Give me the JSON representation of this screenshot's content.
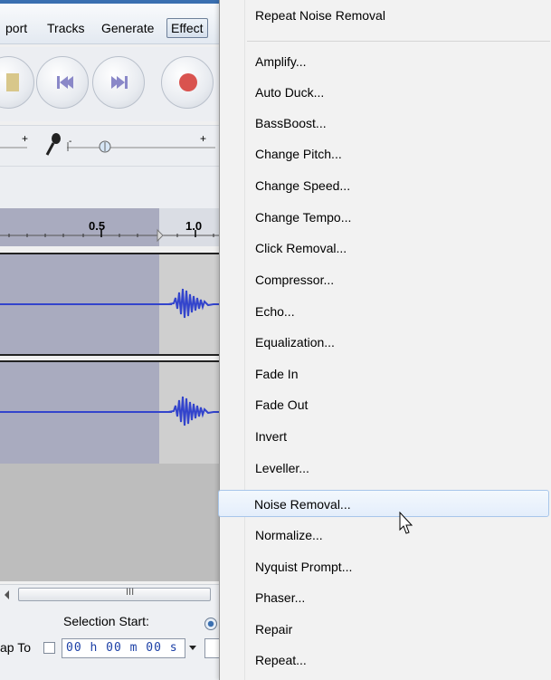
{
  "menubar": {
    "items": [
      {
        "label": "port"
      },
      {
        "label": "Tracks"
      },
      {
        "label": "Generate"
      },
      {
        "label": "Effect"
      }
    ]
  },
  "ruler": {
    "labels": [
      "0.5",
      "1.0"
    ]
  },
  "scroll": {
    "grip": "III"
  },
  "selection": {
    "label": "Selection Start:",
    "snap_label": "ap To",
    "time": "00 h 00 m 00 s"
  },
  "effect_menu": {
    "repeat_item": "Repeat Noise Removal",
    "items": [
      "Amplify...",
      "Auto Duck...",
      "BassBoost...",
      "Change Pitch...",
      "Change Speed...",
      "Change Tempo...",
      "Click Removal...",
      "Compressor...",
      "Echo...",
      "Equalization...",
      "Fade In",
      "Fade Out",
      "Invert",
      "Leveller...",
      "Noise Removal...",
      "Normalize...",
      "Nyquist Prompt...",
      "Phaser...",
      "Repair",
      "Repeat..."
    ],
    "highlighted": "Noise Removal..."
  },
  "colors": {
    "waveform": "#3344cc",
    "selection": "#a9abbf",
    "menu_highlight": "#e4eefb",
    "record": "#d9534f"
  }
}
